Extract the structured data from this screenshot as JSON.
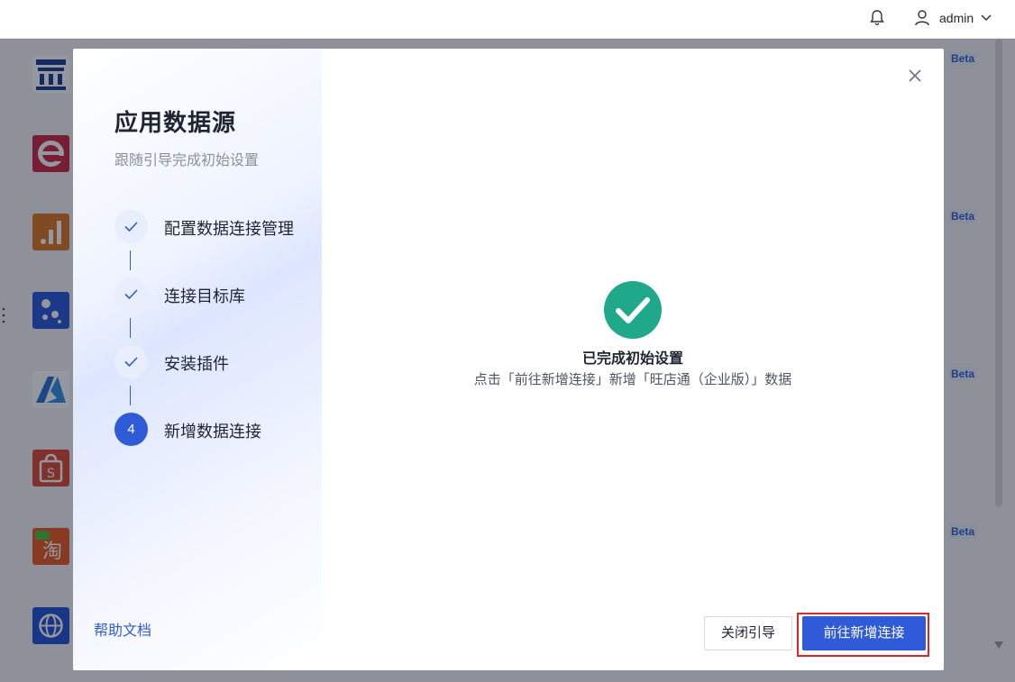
{
  "header": {
    "username": "admin",
    "icons": {
      "notification": "bell-icon",
      "user": "user-icon",
      "dropdown": "chevron-down-icon"
    }
  },
  "background": {
    "beta_badge": "Beta",
    "logos": [
      {
        "name": "bank-logo",
        "color": "#123a8c"
      },
      {
        "name": "e-logo",
        "color": "#c9243f"
      },
      {
        "name": "analytics-logo",
        "color": "#d9751f"
      },
      {
        "name": "dots-logo",
        "color": "#2255d8"
      },
      {
        "name": "azure-logo",
        "color": "#1c6fd1"
      },
      {
        "name": "shopee-logo",
        "color": "#d9462f"
      },
      {
        "name": "taobao-logo",
        "color": "#e8561f"
      },
      {
        "name": "globe-logo",
        "color": "#1d4fd6"
      }
    ]
  },
  "modal": {
    "sidebar": {
      "title": "应用数据源",
      "subtitle": "跟随引导完成初始设置",
      "steps": [
        {
          "label": "配置数据连接管理",
          "status": "done"
        },
        {
          "label": "连接目标库",
          "status": "done"
        },
        {
          "label": "安装插件",
          "status": "done"
        },
        {
          "label": "新增数据连接",
          "status": "active",
          "number": "4"
        }
      ],
      "help_link": "帮助文档"
    },
    "content": {
      "success_title": "已完成初始设置",
      "success_description": "点击「前往新增连接」新增「旺店通（企业版）」数据"
    },
    "buttons": {
      "close_guide": "关闭引导",
      "go_add_connection": "前往新增连接"
    }
  },
  "colors": {
    "primary": "#2f5bd8",
    "success": "#1fa88a",
    "highlight_border": "#e0232b"
  }
}
